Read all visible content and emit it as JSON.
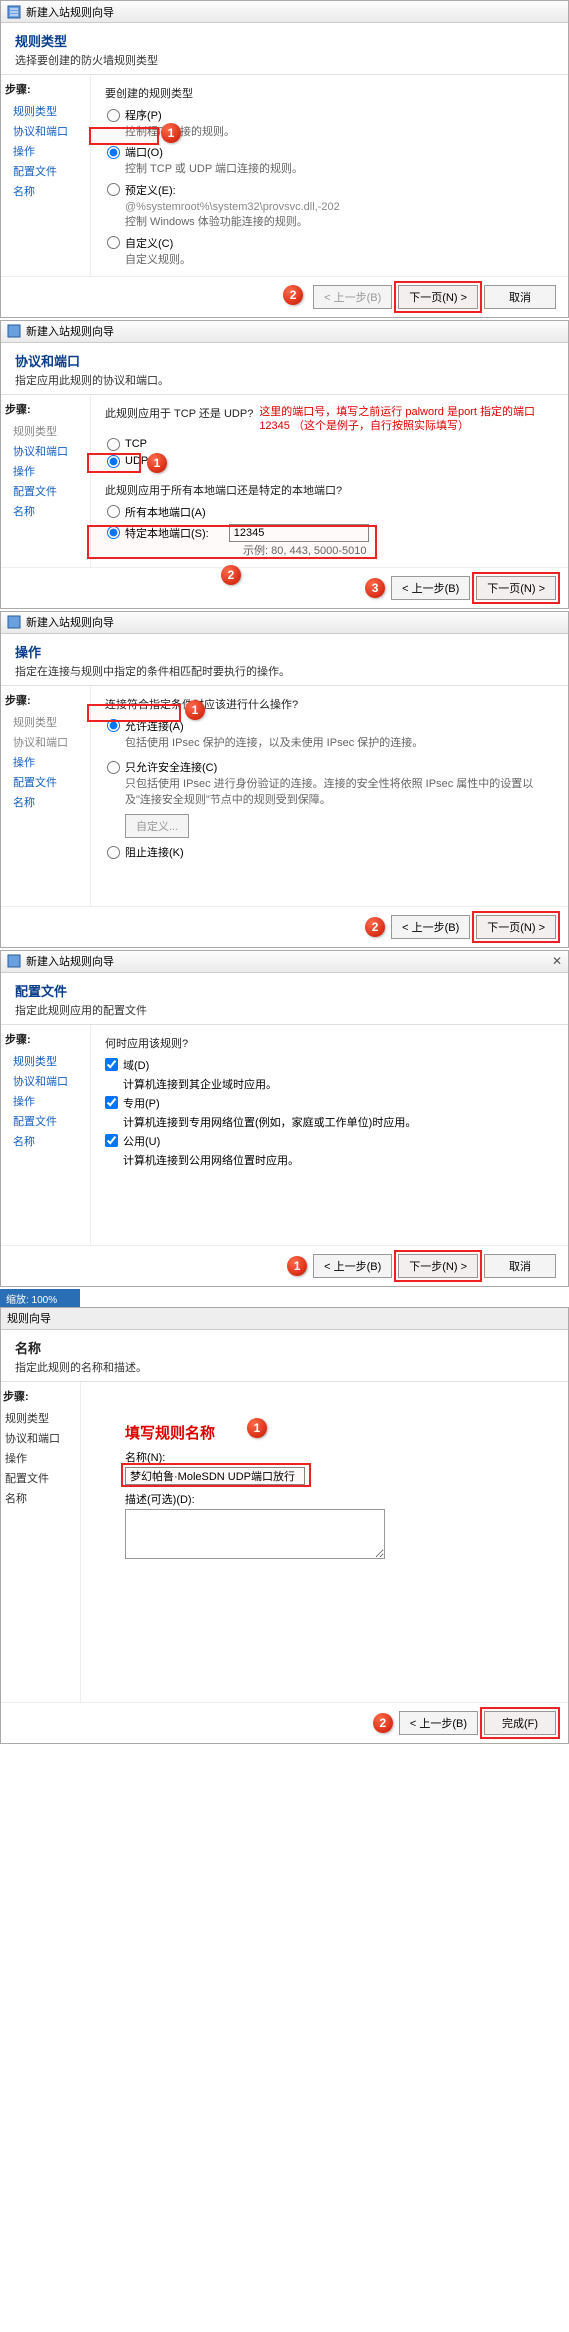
{
  "wiz_title": "新建入站规则向导",
  "side_steps_hdr": "步骤:",
  "steps": {
    "rule_type": "规则类型",
    "proto_port": "协议和端口",
    "action": "操作",
    "profile": "配置文件",
    "name": "名称"
  },
  "p1": {
    "title": "规则类型",
    "sub": "选择要创建的防火墙规则类型",
    "q": "要创建的规则类型",
    "opt_prog": "程序(P)",
    "d_prog": "控制程序连接的规则。",
    "opt_port": "端口(O)",
    "d_port": "控制 TCP 或 UDP 端口连接的规则。",
    "opt_pre": "预定义(E):",
    "d_pre_path": "@%systemroot%\\system32\\provsvc.dll,-202",
    "d_pre": "控制 Windows 体验功能连接的规则。",
    "opt_cust": "自定义(C)",
    "d_cust": "自定义规则。"
  },
  "p2": {
    "title": "协议和端口",
    "sub": "指定应用此规则的协议和端口。",
    "q1": "此规则应用于 TCP 还是 UDP?",
    "opt_tcp": "TCP",
    "opt_udp": "UDP",
    "q2": "此规则应用于所有本地端口还是特定的本地端口?",
    "opt_all": "所有本地端口(A)",
    "opt_spec": "特定本地端口(S):",
    "val": "12345",
    "eg": "示例: 80, 443, 5000-5010",
    "note": "这里的端口号，填写之前运行 palword 是port 指定的端口 12345 （这个是例子，自行按照实际填写）"
  },
  "p3": {
    "title": "操作",
    "sub": "指定在连接与规则中指定的条件相匹配时要执行的操作。",
    "q": "连接符合指定条件时应该进行什么操作?",
    "o1": "允许连接(A)",
    "d1": "包括使用 IPsec 保护的连接，以及未使用 IPsec 保护的连接。",
    "o2": "只允许安全连接(C)",
    "d2": "只包括使用 IPsec 进行身份验证的连接。连接的安全性将依照 IPsec 属性中的设置以及\"连接安全规则\"节点中的规则受到保障。",
    "o2b": "自定义...",
    "o3": "阻止连接(K)"
  },
  "p4": {
    "title": "配置文件",
    "sub": "指定此规则应用的配置文件",
    "q": "何时应用该规则?",
    "c1": "域(D)",
    "c1d": "计算机连接到其企业域时应用。",
    "c2": "专用(P)",
    "c2d": "计算机连接到专用网络位置(例如，家庭或工作单位)时应用。",
    "c3": "公用(U)",
    "c3d": "计算机连接到公用网络位置时应用。"
  },
  "p5": {
    "title": "名称",
    "sub": "指定此规则的名称和描述。",
    "ann": "填写规则名称",
    "l_name": "名称(N):",
    "v_name": "梦幻帕鲁·MoleSDN UDP端口放行",
    "l_desc": "描述(可选)(D):"
  },
  "status": "缩放: 100%",
  "wiz5_title": "规则向导",
  "btn": {
    "back": "< 上一步(B)",
    "next": "下一页(N) >",
    "next2": "下一步(N) >",
    "finish": "完成(F)",
    "cancel": "取消"
  }
}
